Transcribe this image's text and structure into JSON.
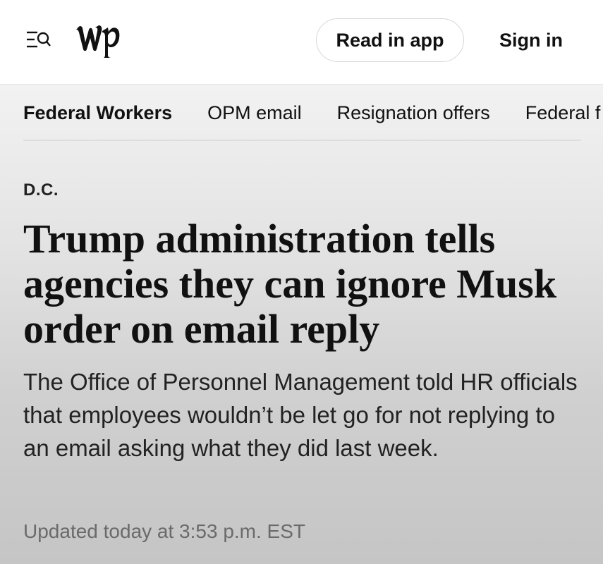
{
  "header": {
    "menu_icon": "menu-search-icon",
    "logo": "wp",
    "read_in_app_label": "Read in app",
    "sign_in_label": "Sign in"
  },
  "topics": [
    {
      "label": "Federal Workers",
      "active": true
    },
    {
      "label": "OPM email"
    },
    {
      "label": "Resignation offers"
    },
    {
      "label": "Federal f"
    }
  ],
  "article": {
    "kicker": "D.C.",
    "headline": "Trump administration tells agencies they can ignore Musk order on email reply",
    "dek": "The Office of Personnel Management told HR officials that employees wouldn’t be let go for not replying to an email asking what they did last week.",
    "timestamp": "Updated today at 3:53 p.m. EST"
  }
}
